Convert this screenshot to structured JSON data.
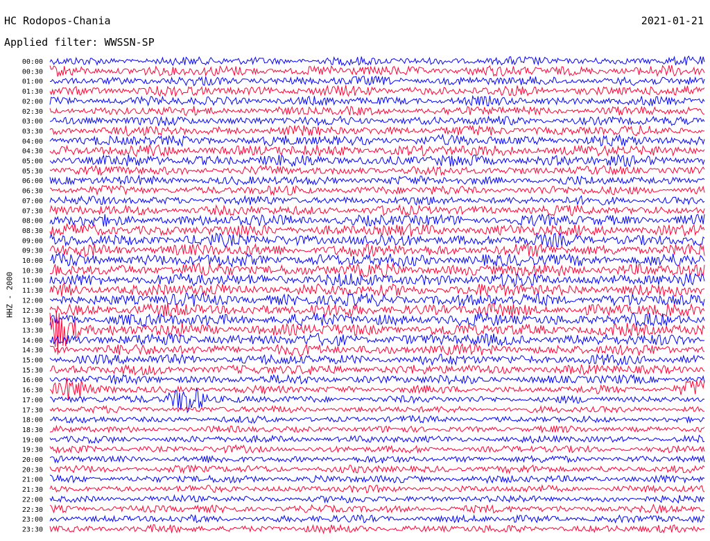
{
  "header": {
    "station": "HC Rodopos-Chania",
    "date": "2021-01-21",
    "filter": "Applied filter: WWSSN-SP"
  },
  "chart_data": {
    "type": "helicorder",
    "title": "HC Rodopos-Chania",
    "ylabel": "HHZ - 2000",
    "colors": [
      "#0000ff",
      "#ff0033"
    ],
    "rows": [
      {
        "time": "00:00",
        "level": 0.55
      },
      {
        "time": "00:30",
        "level": 0.75
      },
      {
        "time": "01:00",
        "level": 0.6
      },
      {
        "time": "01:30",
        "level": 0.7
      },
      {
        "time": "02:00",
        "level": 0.6
      },
      {
        "time": "02:30",
        "level": 0.6
      },
      {
        "time": "03:00",
        "level": 0.6
      },
      {
        "time": "03:30",
        "level": 0.7
      },
      {
        "time": "04:00",
        "level": 0.75
      },
      {
        "time": "04:30",
        "level": 0.85
      },
      {
        "time": "05:00",
        "level": 0.85
      },
      {
        "time": "05:30",
        "level": 0.6
      },
      {
        "time": "06:00",
        "level": 0.6
      },
      {
        "time": "06:30",
        "level": 0.6
      },
      {
        "time": "07:00",
        "level": 0.55
      },
      {
        "time": "07:30",
        "level": 0.7
      },
      {
        "time": "08:00",
        "level": 0.85
      },
      {
        "time": "08:30",
        "level": 0.9
      },
      {
        "time": "09:00",
        "level": 0.95
      },
      {
        "time": "09:30",
        "level": 0.95
      },
      {
        "time": "10:00",
        "level": 1.0
      },
      {
        "time": "10:30",
        "level": 1.0
      },
      {
        "time": "11:00",
        "level": 1.0
      },
      {
        "time": "11:30",
        "level": 1.0
      },
      {
        "time": "12:00",
        "level": 1.0
      },
      {
        "time": "12:30",
        "level": 1.0
      },
      {
        "time": "13:00",
        "level": 1.0
      },
      {
        "time": "13:30",
        "level": 0.95
      },
      {
        "time": "14:00",
        "level": 0.9
      },
      {
        "time": "14:30",
        "level": 0.8
      },
      {
        "time": "15:00",
        "level": 0.75
      },
      {
        "time": "15:30",
        "level": 0.7
      },
      {
        "time": "16:00",
        "level": 0.6
      },
      {
        "time": "16:30",
        "level": 0.45
      },
      {
        "time": "17:00",
        "level": 0.4
      },
      {
        "time": "17:30",
        "level": 0.35
      },
      {
        "time": "18:00",
        "level": 0.35
      },
      {
        "time": "18:30",
        "level": 0.35
      },
      {
        "time": "19:00",
        "level": 0.4
      },
      {
        "time": "19:30",
        "level": 0.4
      },
      {
        "time": "20:00",
        "level": 0.4
      },
      {
        "time": "20:30",
        "level": 0.45
      },
      {
        "time": "21:00",
        "level": 0.45
      },
      {
        "time": "21:30",
        "level": 0.4
      },
      {
        "time": "22:00",
        "level": 0.4
      },
      {
        "time": "22:30",
        "level": 0.45
      },
      {
        "time": "23:00",
        "level": 0.45
      },
      {
        "time": "23:30",
        "level": 0.45
      }
    ],
    "events": [
      {
        "time": "17:00",
        "position": 0.21,
        "scale": 2.5
      },
      {
        "time": "16:30",
        "position": 0.03,
        "scale": 1.6
      },
      {
        "time": "13:30",
        "position": 0.01,
        "scale": 2.2
      },
      {
        "time": "16:30",
        "position": 0.99,
        "scale": 1.4
      }
    ]
  }
}
